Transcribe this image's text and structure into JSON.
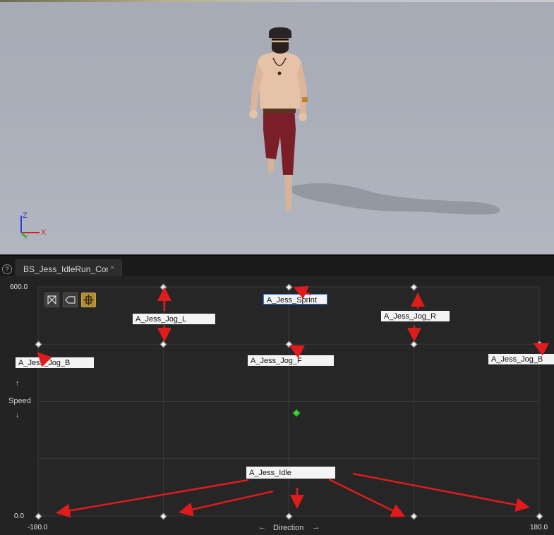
{
  "viewport": {
    "axes": {
      "z": "Z",
      "x": "X",
      "y": "Y"
    }
  },
  "tab": {
    "title": "BS_Jess_IdleRun_Con",
    "close": "×"
  },
  "toolbar": {
    "help": "?",
    "buttons": [
      "triangulate-icon",
      "tag-icon",
      "fit-view-icon"
    ]
  },
  "graph": {
    "y_max": "600.0",
    "y_min": "0.0",
    "x_min": "-180.0",
    "x_max": "180.0",
    "y_axis_label": "Speed",
    "x_axis_label": "Direction",
    "up_arrow": "↑",
    "down_arrow": "↓",
    "left_arrow": "←",
    "right_arrow": "→"
  },
  "samples": [
    {
      "label": "A_Jess_Jog_L",
      "direction": -90,
      "speed": 600
    },
    {
      "label": "A_Jess_Sprint",
      "direction": 0,
      "speed": 600
    },
    {
      "label": "A_Jess_Jog_R",
      "direction": 90,
      "speed": 600
    },
    {
      "label": "A_Jess_Jog_B",
      "direction": -180,
      "speed": 450
    },
    {
      "label": "A_Jess_Jog_L",
      "direction": -90,
      "speed": 450
    },
    {
      "label": "A_Jess_Jog_F",
      "direction": 0,
      "speed": 450
    },
    {
      "label": "A_Jess_Jog_R",
      "direction": 90,
      "speed": 450
    },
    {
      "label": "A_Jess_Jog_B",
      "direction": 180,
      "speed": 450
    },
    {
      "label": "A_Jess_Idle",
      "direction": -180,
      "speed": 0
    },
    {
      "label": "A_Jess_Idle",
      "direction": -90,
      "speed": 0
    },
    {
      "label": "A_Jess_Idle",
      "direction": 0,
      "speed": 0
    },
    {
      "label": "A_Jess_Idle",
      "direction": 90,
      "speed": 0
    },
    {
      "label": "A_Jess_Idle",
      "direction": 180,
      "speed": 0
    }
  ],
  "labels": {
    "jog_l": "A_Jess_Jog_L",
    "sprint": "A_Jess_Sprint",
    "jog_r": "A_Jess_Jog_R",
    "jog_b_left": "A_Jess_Jog_B",
    "jog_f": "A_Jess_Jog_F",
    "jog_b_right": "A_Jess_Jog_B",
    "idle": "A_Jess_Idle"
  },
  "preview": {
    "direction": 0,
    "speed": 270
  },
  "colors": {
    "arrow": "#e01b1b",
    "preview": "#3ad33a",
    "active_tool": "#b08c34"
  }
}
